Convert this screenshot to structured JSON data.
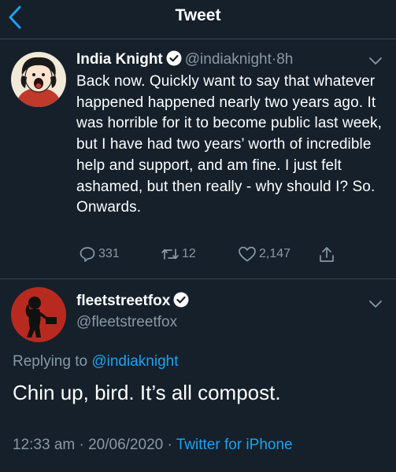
{
  "header": {
    "title": "Tweet"
  },
  "original_tweet": {
    "author_name": "India Knight",
    "handle": "@indiaknight",
    "separator": "·",
    "time": "8h",
    "text": "Back now. Quickly want to say that whatever happened happened nearly two years ago. It was horrible for it to become public last week, but I have had two years’ worth of incredible help and support, and am fine. I just felt ashamed, but then really - why should I? So. Onwards.",
    "replies": "331",
    "retweets": "12",
    "likes": "2,147"
  },
  "reply_tweet": {
    "author_name": "fleetstreetfox",
    "handle": "@fleetstreetfox",
    "replying_prefix": "Replying to",
    "replying_to": "@indiaknight",
    "text": "Chin up, bird. It’s all compost.",
    "timestamp": "12:33 am · 20/06/2020 ·",
    "source": "Twitter for iPhone"
  },
  "colors": {
    "background": "#15202b",
    "accent": "#1da1f2",
    "secondary_text": "#8899a6",
    "divider": "#38444d"
  },
  "icons": [
    "back-chevron-icon",
    "verified-badge-icon",
    "chevron-down-icon",
    "reply-icon",
    "retweet-icon",
    "like-icon",
    "share-icon"
  ]
}
